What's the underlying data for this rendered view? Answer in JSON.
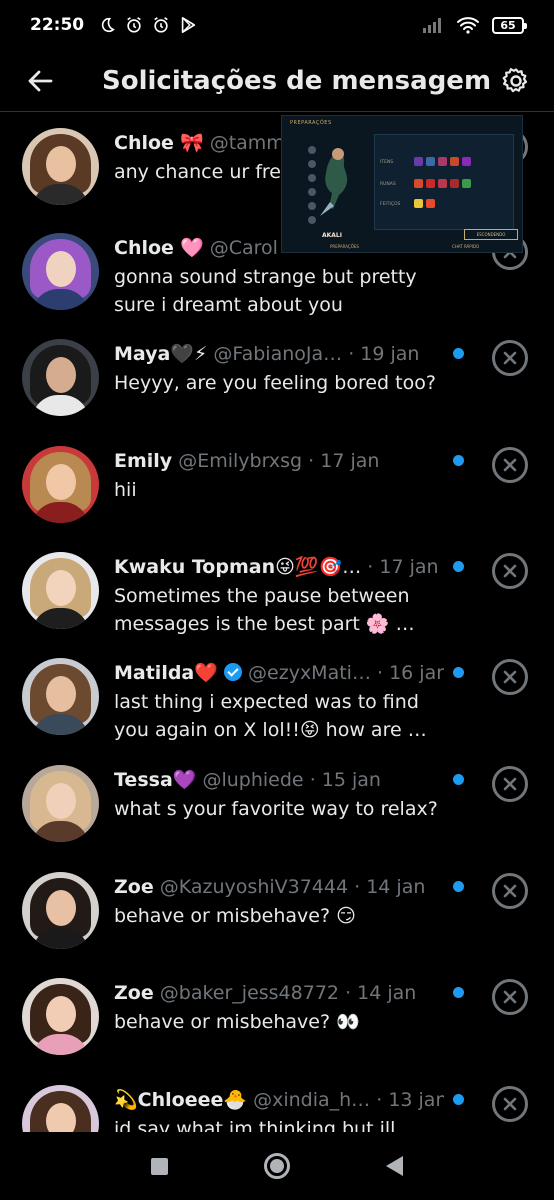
{
  "status_bar": {
    "time": "22:50",
    "battery": "65"
  },
  "header": {
    "title": "Solicitações de mensagem"
  },
  "conversations": [
    {
      "name": "Chloe",
      "emoji": "🎀",
      "handle": "@tamm",
      "date": "",
      "message": "any chance ur fre",
      "unread": false,
      "verified": false
    },
    {
      "name": "Chloe",
      "emoji": "🩷",
      "handle": "@Carol",
      "date": "",
      "message": "gonna sound strange but pretty sure i dreamt about you",
      "unread": false,
      "verified": false
    },
    {
      "name": "Maya",
      "emoji": "🖤⚡",
      "handle": "@FabianoJa…",
      "date": "· 19 jan",
      "message": "Heyyy, are you feeling bored too?",
      "unread": true,
      "verified": false
    },
    {
      "name": "Emily",
      "emoji": "",
      "handle": "@Emilybrxsg",
      "date": "· 17 jan",
      "message": "hii",
      "unread": true,
      "verified": false
    },
    {
      "name": "Kwaku Topman",
      "emoji": "😜💯🎯…",
      "handle": "",
      "date": "· 17 jan",
      "message": "Sometimes the pause between messages is the best part 🌸 …",
      "unread": true,
      "verified": false
    },
    {
      "name": "Matilda",
      "emoji": "❤️",
      "handle": "@ezyxMati…",
      "date": "· 16 jan",
      "message": "last thing i expected was to find you again on X lol!!😝 how are …",
      "unread": true,
      "verified": true
    },
    {
      "name": "Tessa",
      "emoji": "💜",
      "handle": "@luphiede",
      "date": "· 15 jan",
      "message": "what s your favorite way to relax?",
      "unread": true,
      "verified": false
    },
    {
      "name": "Zoe",
      "emoji": "",
      "handle": "@KazuyoshiV37444",
      "date": "· 14 jan",
      "message": "behave or misbehave? 😏",
      "unread": true,
      "verified": false
    },
    {
      "name": "Zoe",
      "emoji": "",
      "handle": "@baker_jess48772",
      "date": "· 14 jan",
      "message": "behave or misbehave? 👀",
      "unread": true,
      "verified": false
    },
    {
      "name": "Chloeee",
      "emoji": "💫",
      "emoji_after": "🐣",
      "handle": "@xindia_h…",
      "date": "· 13 jan",
      "message": "id say what im thinking but ill",
      "unread": true,
      "verified": false
    }
  ],
  "overlay": {
    "title": "PREPARAÇÕES",
    "rows": [
      "ITENS",
      "RUNAS",
      "FEITIÇOS"
    ],
    "champion": "AKALI",
    "button": "ESCONDENDO",
    "footer_left": "PREPARAÇÕES",
    "footer_right": "CHAT RÁPIDO"
  },
  "colors": {
    "accent": "#1d9bf0",
    "muted": "#71767b",
    "text": "#e7e9ea",
    "background": "#000000"
  }
}
